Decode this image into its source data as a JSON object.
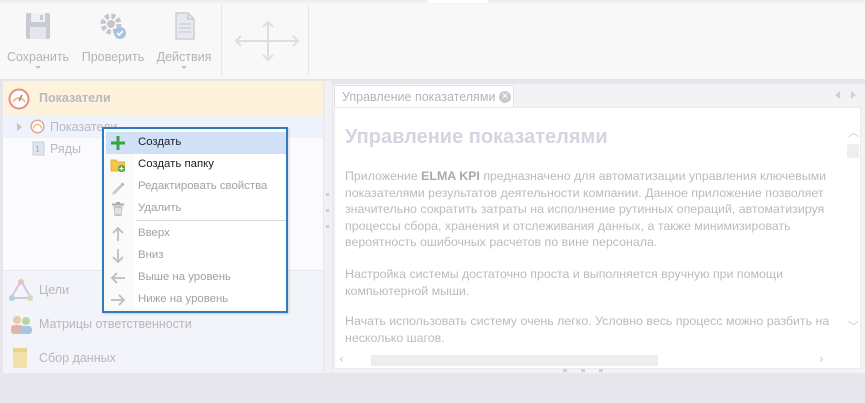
{
  "toolbar": {
    "buttons": [
      {
        "label": "Сохранить",
        "icon": "floppy-disk-icon",
        "has_dropdown": true
      },
      {
        "label": "Проверить",
        "icon": "gear-check-icon",
        "has_dropdown": false
      },
      {
        "label": "Действия",
        "icon": "document-icon",
        "has_dropdown": true
      }
    ],
    "move_icon": "move-arrows-icon"
  },
  "left_panel": {
    "header": {
      "title": "Показатели",
      "icon": "gauge-icon"
    },
    "tree": [
      {
        "label": "Показатели",
        "icon": "gauge-icon",
        "selected": true,
        "expandable": true
      },
      {
        "label": "Ряды",
        "icon": "series-icon",
        "selected": false,
        "expandable": false
      }
    ],
    "sections": [
      {
        "label": "Цели",
        "icon": "goals-icon"
      },
      {
        "label": "Матрицы ответственности",
        "icon": "people-icon"
      },
      {
        "label": "Сбор данных",
        "icon": "database-icon"
      }
    ]
  },
  "tab": {
    "label": "Управление показателями",
    "close_icon": "close-icon"
  },
  "content": {
    "title": "Управление показателями",
    "para1_pre": "Приложение ",
    "para1_bold": "ELMA KPI",
    "para1_post": " предназначено для автоматизации управления ключевыми показателями результатов деятельности компании. Данное приложение позволяет значительно сократить затраты на исполнение рутинных операций, автоматизируя процессы сбора, хранения и отслеживания данных, а также минимизировать вероятность ошибочных расчетов по вине персонала.",
    "para2": "Настройка системы достаточно проста и выполняется вручную при помощи компьютерной мыши.",
    "para3": "Начать использовать систему очень легко. Условно весь процесс можно разбить на несколько шагов."
  },
  "context_menu": {
    "items": [
      {
        "label": "Создать",
        "icon": "plus-icon",
        "enabled": true,
        "highlighted": true
      },
      {
        "label": "Создать папку",
        "icon": "folder-add-icon",
        "enabled": true,
        "highlighted": false
      },
      {
        "label": "Редактировать свойства",
        "icon": "pencil-icon",
        "enabled": false,
        "highlighted": false
      },
      {
        "label": "Удалить",
        "icon": "trash-icon",
        "enabled": false,
        "highlighted": false
      },
      {
        "label": "Вверх",
        "icon": "arrow-up-icon",
        "enabled": false,
        "highlighted": false
      },
      {
        "label": "Вниз",
        "icon": "arrow-down-icon",
        "enabled": false,
        "highlighted": false
      },
      {
        "label": "Выше на уровень",
        "icon": "arrow-left-icon",
        "enabled": false,
        "highlighted": false
      },
      {
        "label": "Ниже на уровень",
        "icon": "arrow-right-icon",
        "enabled": false,
        "highlighted": false
      }
    ]
  },
  "colors": {
    "menu_border": "#2f7bbd",
    "menu_highlight": "#cfe0f7",
    "plus_green": "#3aa53a",
    "header_bg": "#fdf3dc"
  }
}
